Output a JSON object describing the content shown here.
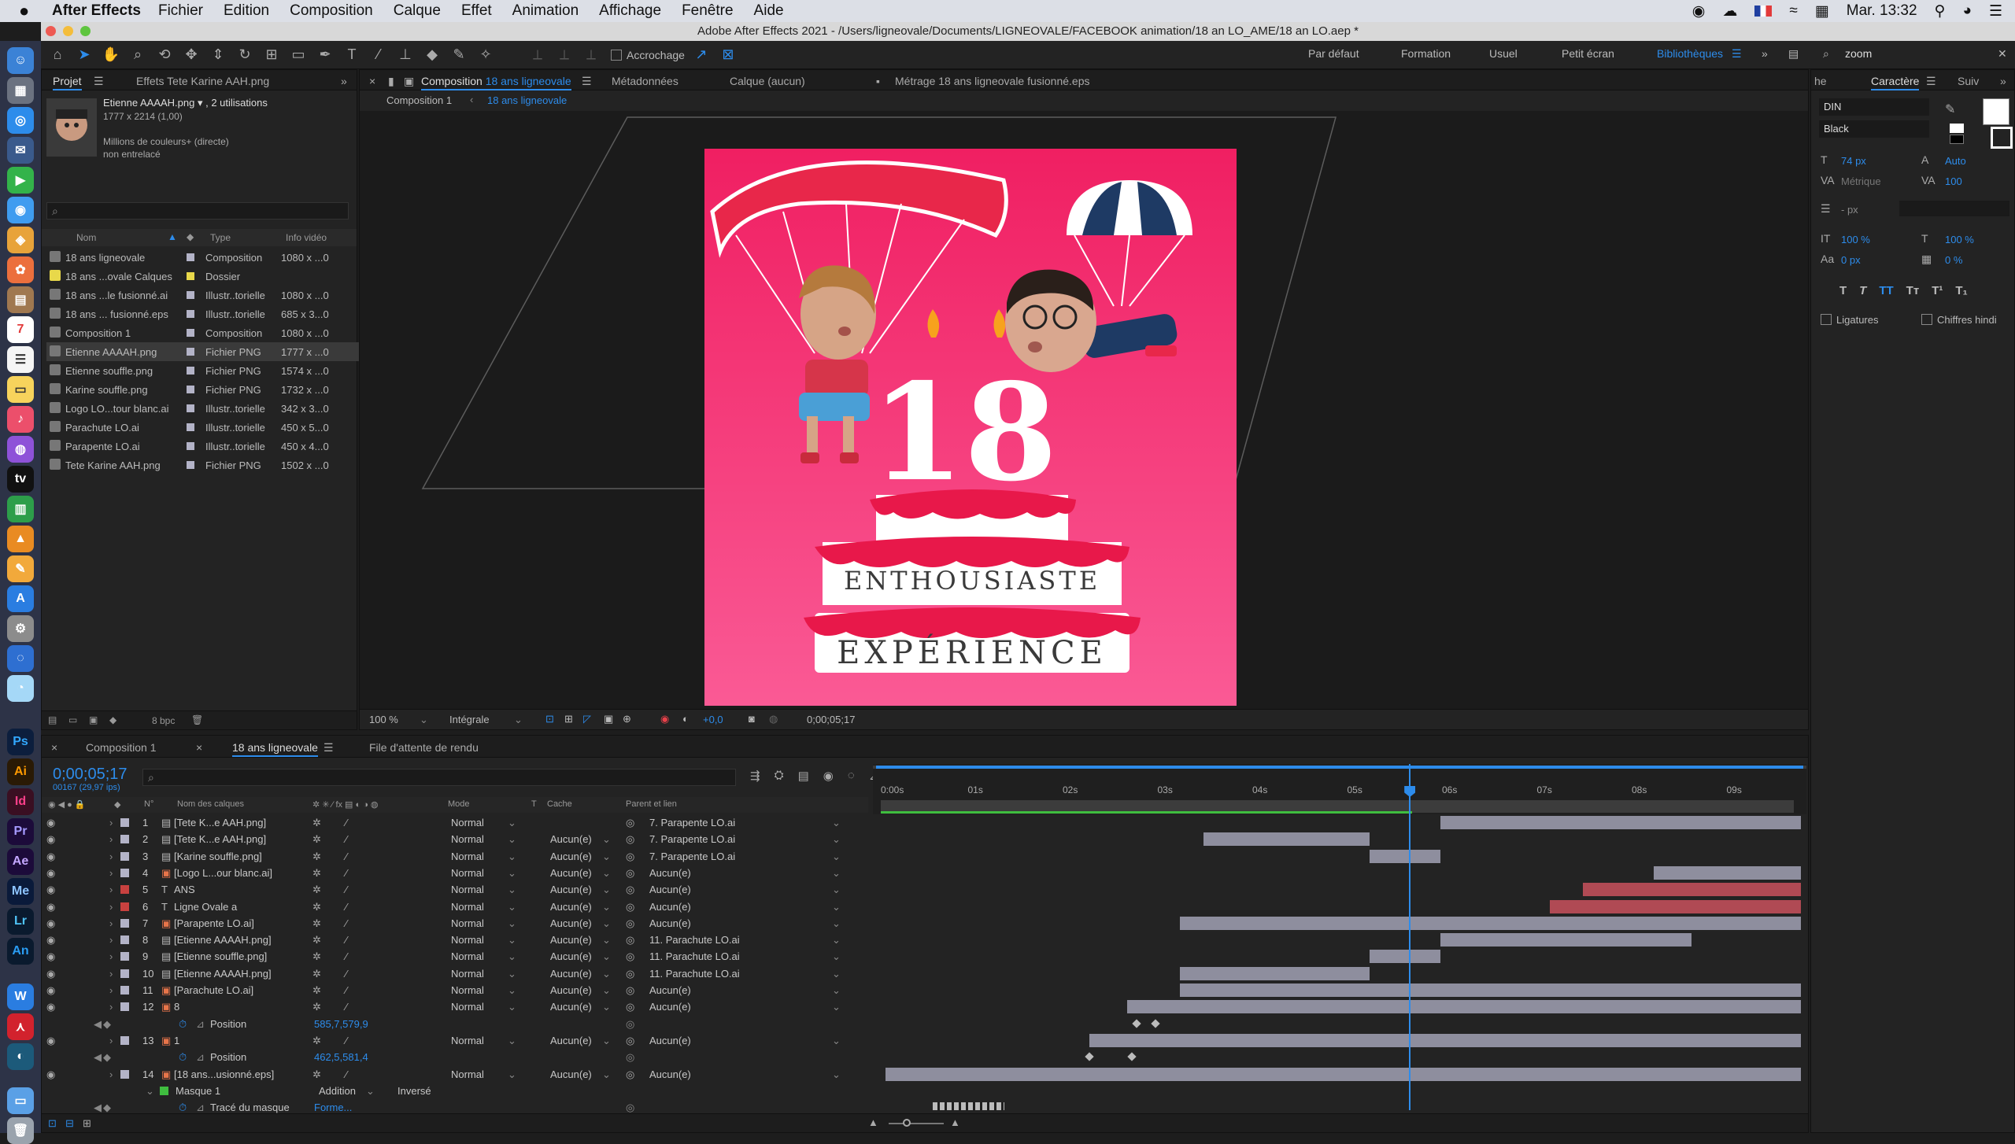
{
  "menubar": {
    "apple": "",
    "app_name": "After Effects",
    "items": [
      "Fichier",
      "Edition",
      "Composition",
      "Calque",
      "Effet",
      "Animation",
      "Affichage",
      "Fenêtre",
      "Aide"
    ],
    "clock": "Mar. 13:32"
  },
  "window": {
    "title": "Adobe After Effects 2021 - /Users/ligneovale/Documents/LIGNEOVALE/FACEBOOK animation/18 an LO_AME/18 an LO.aep *"
  },
  "toolbar": {
    "snap_label": "Accrochage",
    "workspaces": [
      "Par défaut",
      "Formation",
      "Usuel",
      "Petit écran",
      "Bibliothèques"
    ],
    "search_value": "zoom"
  },
  "project": {
    "tab_label": "Projet",
    "effects_tab": "Effets  Tete Karine AAH.png",
    "selected_name": "Etienne AAAAH.png ▾ , 2 utilisations",
    "dims": "1777 x 2214 (1,00)",
    "colors": "Millions de couleurs+ (directe)",
    "interlace": "non entrelacé",
    "col_name": "Nom",
    "col_type": "Type",
    "col_info": "Info vidéo",
    "bpc": "8 bpc",
    "items": [
      {
        "name": "18 ans ligneovale",
        "type": "Composition",
        "info": "1080 x ...0",
        "color": "#b3b3c7"
      },
      {
        "name": "18 ans ...ovale Calques",
        "type": "Dossier",
        "info": "",
        "color": "#e8d84a"
      },
      {
        "name": "18 ans ...le fusionné.ai",
        "type": "Illustr..torielle",
        "info": "1080 x ...0",
        "color": "#b3b3c7"
      },
      {
        "name": "18 ans ... fusionné.eps",
        "type": "Illustr..torielle",
        "info": "685 x 3...0",
        "color": "#b3b3c7"
      },
      {
        "name": "Composition 1",
        "type": "Composition",
        "info": "1080 x ...0",
        "color": "#b3b3c7"
      },
      {
        "name": "Etienne AAAAH.png",
        "type": "Fichier PNG",
        "info": "1777 x ...0",
        "color": "#b3b3c7"
      },
      {
        "name": "Etienne souffle.png",
        "type": "Fichier PNG",
        "info": "1574 x ...0",
        "color": "#b3b3c7"
      },
      {
        "name": "Karine souffle.png",
        "type": "Fichier PNG",
        "info": "1732 x ...0",
        "color": "#b3b3c7"
      },
      {
        "name": "Logo LO...tour blanc.ai",
        "type": "Illustr..torielle",
        "info": "342 x 3...0",
        "color": "#b3b3c7"
      },
      {
        "name": "Parachute LO.ai",
        "type": "Illustr..torielle",
        "info": "450 x 5...0",
        "color": "#b3b3c7"
      },
      {
        "name": "Parapente LO.ai",
        "type": "Illustr..torielle",
        "info": "450 x 4...0",
        "color": "#b3b3c7"
      },
      {
        "name": "Tete Karine AAH.png",
        "type": "Fichier PNG",
        "info": "1502 x ...0",
        "color": "#b3b3c7"
      }
    ]
  },
  "viewer": {
    "tab_comp": "Composition",
    "tab_comp_name": "18 ans ligneovale",
    "tab_meta": "Métadonnées",
    "tab_layer": "Calque  (aucun)",
    "tab_footage": "Métrage  18 ans ligneovale fusionné.eps",
    "crumb1": "Composition 1",
    "crumb2": "18 ans ligneovale",
    "zoom": "100 %",
    "resolution": "Intégrale",
    "exposure": "+0,0",
    "timecode": "0;00;05;17",
    "artwork": {
      "number": "18",
      "word1": "ENTHOUSIASTE",
      "word2": "EXPÉRIENCE",
      "bg": "#f2266a"
    }
  },
  "character": {
    "tab_label": "Caractère",
    "tab_left": "he",
    "tab_right": "Suiv",
    "font": "DIN",
    "style": "Black",
    "size": "74 px",
    "leading": "Auto",
    "kerning": "Métrique",
    "tracking": "100",
    "stroke": "- px",
    "vscale": "100 %",
    "hscale": "100 %",
    "baseline": "0 px",
    "tsume": "0 %",
    "ligatures": "Ligatures",
    "hindi": "Chiffres hindi"
  },
  "timeline": {
    "tab1": "Composition 1",
    "tab2": "18 ans ligneovale",
    "tab3": "File d'attente de rendu",
    "timecode": "0;00;05;17",
    "frames": "00167 (29,97 ips)",
    "col_num": "N°",
    "col_name": "Nom des calques",
    "col_mode": "Mode",
    "col_t": "T",
    "col_cache": "Cache",
    "col_parent": "Parent et lien",
    "ruler": [
      "0:00s",
      "01s",
      "02s",
      "03s",
      "04s",
      "05s",
      "06s",
      "07s",
      "08s",
      "09s"
    ],
    "current_time_s": 5.57,
    "layers": [
      {
        "num": "1",
        "name": "[Tete K...e AAH.png]",
        "mode": "Normal",
        "cache": "",
        "parent": "7. Parapente LO.ai",
        "in": 5.9,
        "out": 9.7,
        "red": false,
        "label": "#b3b3c7",
        "kind": "img"
      },
      {
        "num": "2",
        "name": "[Tete K...e AAH.png]",
        "mode": "Normal",
        "cache": "Aucun(e)",
        "parent": "7. Parapente LO.ai",
        "in": 3.4,
        "out": 5.15,
        "red": false,
        "label": "#b3b3c7",
        "kind": "img"
      },
      {
        "num": "3",
        "name": "[Karine souffle.png]",
        "mode": "Normal",
        "cache": "Aucun(e)",
        "parent": "7. Parapente LO.ai",
        "in": 5.15,
        "out": 5.9,
        "red": false,
        "label": "#b3b3c7",
        "kind": "img"
      },
      {
        "num": "4",
        "name": "[Logo L...our blanc.ai]",
        "mode": "Normal",
        "cache": "Aucun(e)",
        "parent": "Aucun(e)",
        "in": 8.15,
        "out": 9.7,
        "red": false,
        "label": "#b3b3c7",
        "kind": "ai"
      },
      {
        "num": "5",
        "name": "ANS",
        "mode": "Normal",
        "cache": "Aucun(e)",
        "parent": "Aucun(e)",
        "in": 7.4,
        "out": 9.7,
        "red": true,
        "label": "#c8413f",
        "kind": "text"
      },
      {
        "num": "6",
        "name": "Ligne Ovale a",
        "mode": "Normal",
        "cache": "Aucun(e)",
        "parent": "Aucun(e)",
        "in": 7.05,
        "out": 9.7,
        "red": true,
        "label": "#c8413f",
        "kind": "text"
      },
      {
        "num": "7",
        "name": "[Parapente LO.ai]",
        "mode": "Normal",
        "cache": "Aucun(e)",
        "parent": "Aucun(e)",
        "in": 3.15,
        "out": 9.7,
        "red": false,
        "label": "#b3b3c7",
        "kind": "ai"
      },
      {
        "num": "8",
        "name": "[Etienne AAAAH.png]",
        "mode": "Normal",
        "cache": "Aucun(e)",
        "parent": "11. Parachute LO.ai",
        "in": 5.9,
        "out": 8.55,
        "red": false,
        "label": "#b3b3c7",
        "kind": "img"
      },
      {
        "num": "9",
        "name": "[Etienne souffle.png]",
        "mode": "Normal",
        "cache": "Aucun(e)",
        "parent": "11. Parachute LO.ai",
        "in": 5.15,
        "out": 5.9,
        "red": false,
        "label": "#b3b3c7",
        "kind": "img"
      },
      {
        "num": "10",
        "name": "[Etienne AAAAH.png]",
        "mode": "Normal",
        "cache": "Aucun(e)",
        "parent": "11. Parachute LO.ai",
        "in": 3.15,
        "out": 5.15,
        "red": false,
        "label": "#b3b3c7",
        "kind": "img"
      },
      {
        "num": "11",
        "name": "[Parachute LO.ai]",
        "mode": "Normal",
        "cache": "Aucun(e)",
        "parent": "Aucun(e)",
        "in": 3.15,
        "out": 9.7,
        "red": false,
        "label": "#b3b3c7",
        "kind": "ai"
      },
      {
        "num": "12",
        "name": "8",
        "mode": "Normal",
        "cache": "Aucun(e)",
        "parent": "Aucun(e)",
        "in": 2.6,
        "out": 9.7,
        "red": false,
        "label": "#b3b3c7",
        "kind": "ai"
      },
      {
        "num": "",
        "name": "Position",
        "mode": "",
        "cache": "",
        "parent": "",
        "value": "585,7,579,9",
        "keys": [
          2.7,
          2.9
        ],
        "sub": true
      },
      {
        "num": "13",
        "name": "1",
        "mode": "Normal",
        "cache": "Aucun(e)",
        "parent": "Aucun(e)",
        "in": 2.2,
        "out": 9.7,
        "red": false,
        "label": "#b3b3c7",
        "kind": "ai"
      },
      {
        "num": "",
        "name": "Position",
        "mode": "",
        "cache": "",
        "parent": "",
        "value": "462,5,581,4",
        "keys": [
          2.2,
          2.65
        ],
        "sub": true
      },
      {
        "num": "14",
        "name": "[18 ans...usionné.eps]",
        "mode": "Normal",
        "cache": "Aucun(e)",
        "parent": "Aucun(e)",
        "in": 0.05,
        "out": 9.7,
        "red": false,
        "label": "#b3b3c7",
        "kind": "ai"
      },
      {
        "num": "",
        "name": "Masque 1",
        "mode": "Addition",
        "cache": "Inversé",
        "parent": "",
        "sub": true,
        "mask": true
      },
      {
        "num": "",
        "name": "Tracé du masque",
        "mode": "",
        "cache": "",
        "parent": "",
        "value": "Forme...",
        "sub": true
      }
    ]
  }
}
